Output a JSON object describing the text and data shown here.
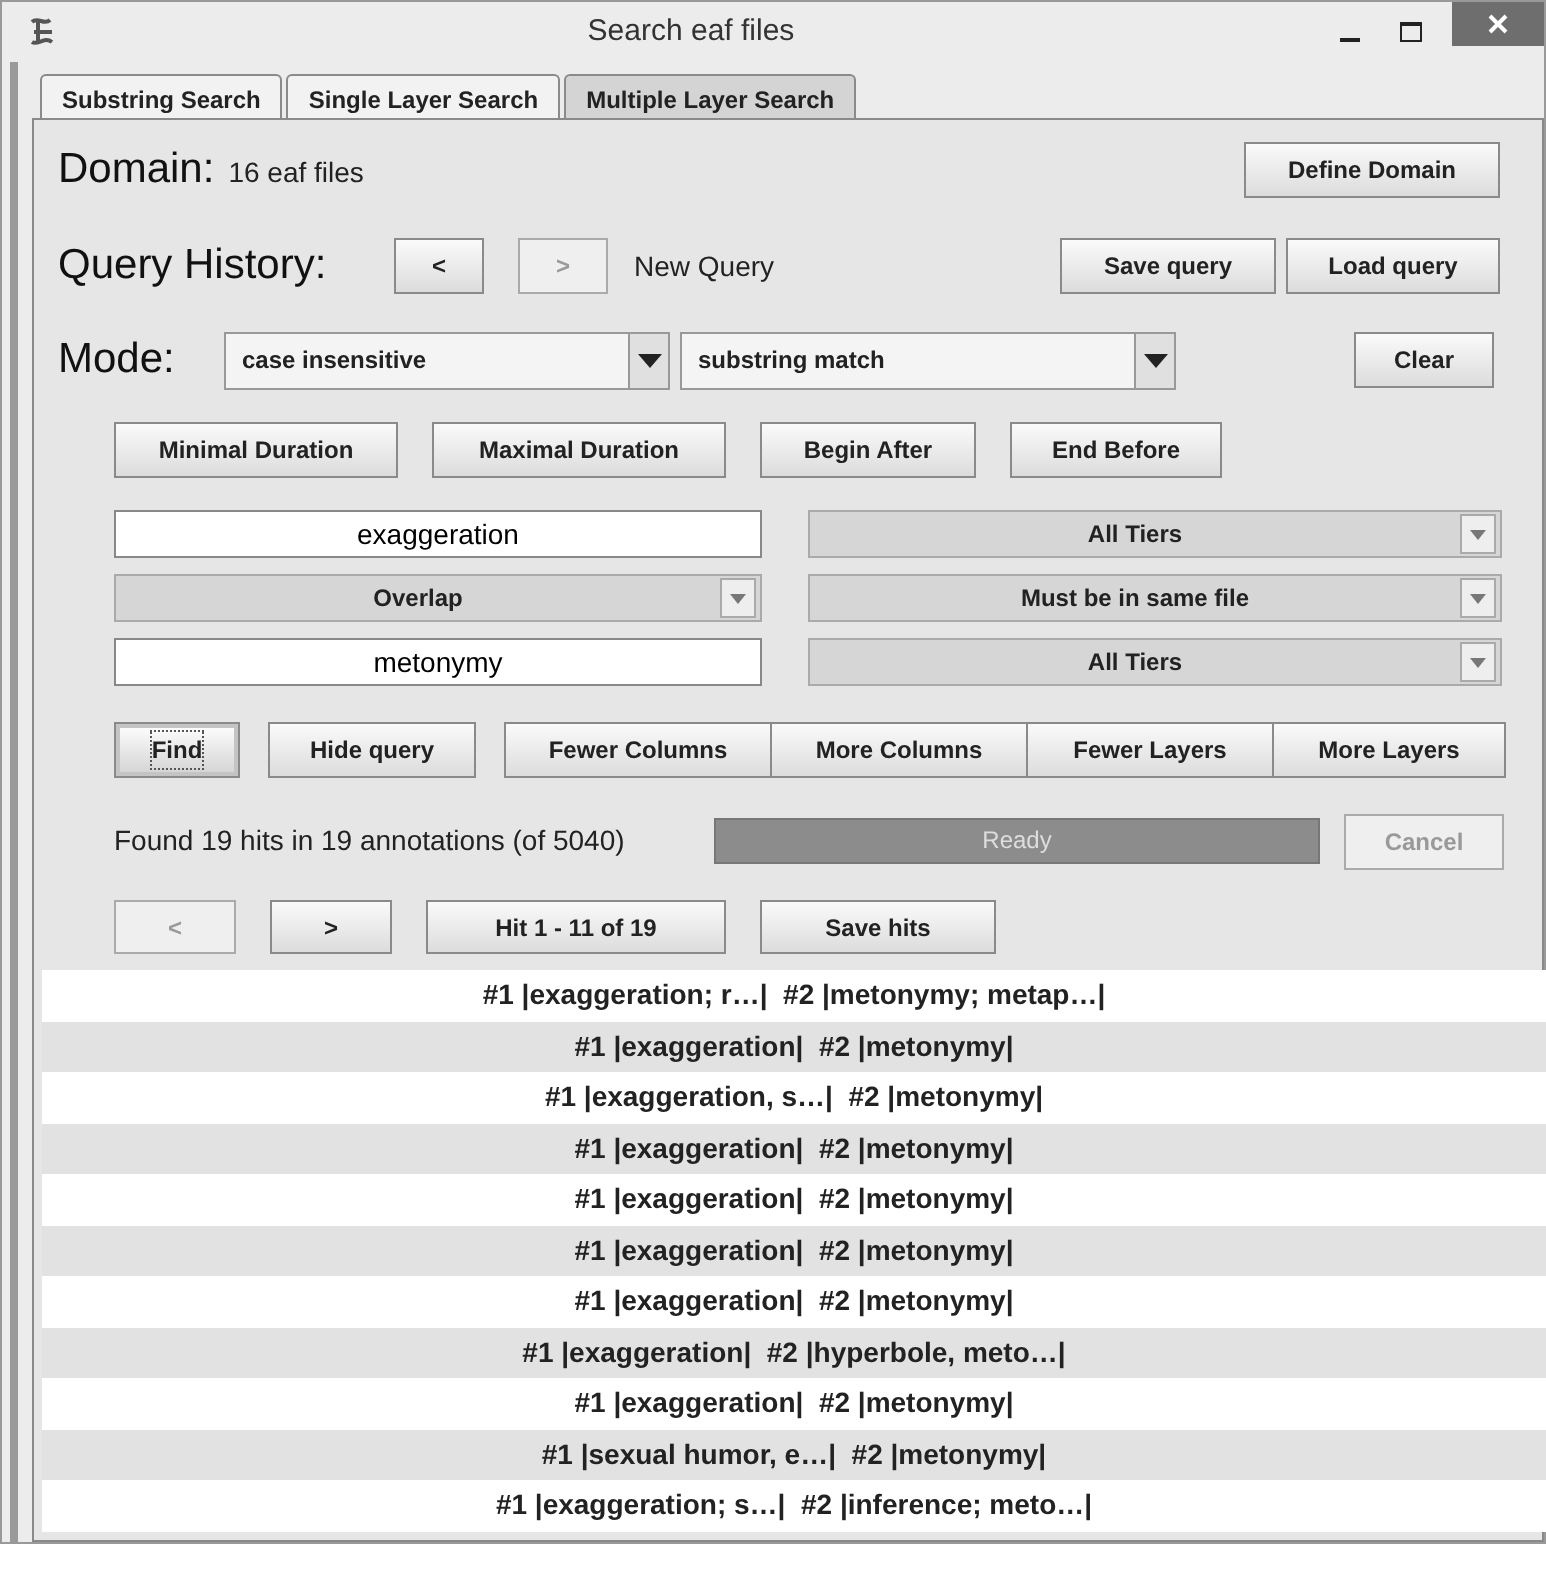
{
  "window": {
    "title": "Search eaf files"
  },
  "tabs": [
    {
      "label": "Substring Search",
      "selected": false
    },
    {
      "label": "Single Layer Search",
      "selected": false
    },
    {
      "label": "Multiple Layer Search",
      "selected": true
    }
  ],
  "domain": {
    "label": "Domain:",
    "value": "16 eaf files",
    "button": "Define Domain"
  },
  "query_history": {
    "label": "Query History:",
    "nav": [
      {
        "label": "<",
        "disabled": false
      },
      {
        "label": ">",
        "disabled": true
      }
    ],
    "status": "New Query",
    "buttons": [
      "Save query",
      "Load query"
    ]
  },
  "mode": {
    "label": "Mode:",
    "dropdowns": [
      "case insensitive",
      "substring match"
    ],
    "button": "Clear"
  },
  "constraints": [
    "Minimal Duration",
    "Maximal Duration",
    "Begin After",
    "End Before"
  ],
  "query_rows": [
    {
      "kind": "field",
      "value": "exaggeration",
      "tier": "All Tiers"
    },
    {
      "kind": "select",
      "value": "Overlap",
      "tier": "Must be in same file"
    },
    {
      "kind": "field",
      "value": "metonymy",
      "tier": "All Tiers"
    }
  ],
  "actions": [
    {
      "label": "Find",
      "kind": "single",
      "focused": true
    },
    {
      "label": "Hide query",
      "kind": "single",
      "focused": false
    },
    {
      "label": "Fewer Columns",
      "kind": "joined",
      "focused": false
    },
    {
      "label": "More Columns",
      "kind": "joined",
      "focused": false
    },
    {
      "label": "Fewer Layers",
      "kind": "joined",
      "focused": false
    },
    {
      "label": "More Layers",
      "kind": "joined",
      "focused": false
    }
  ],
  "status": {
    "text": "Found 19 hits in 19 annotations (of 5040)",
    "progress": {
      "label": "Ready",
      "level": 1
    },
    "cancel": {
      "label": "Cancel",
      "disabled": true
    }
  },
  "hits_nav": [
    {
      "label": "<",
      "disabled": true
    },
    {
      "label": ">",
      "disabled": false
    },
    {
      "label": "Hit 1 - 11 of 19",
      "disabled": false
    },
    {
      "label": "Save hits",
      "disabled": false
    }
  ],
  "results": [
    "#1 |exaggeration; r…|  #2 |metonymy; metap…|",
    "#1 |exaggeration|  #2 |metonymy|",
    "#1 |exaggeration, s…|  #2 |metonymy|",
    "#1 |exaggeration|  #2 |metonymy|",
    "#1 |exaggeration|  #2 |metonymy|",
    "#1 |exaggeration|  #2 |metonymy|",
    "#1 |exaggeration|  #2 |metonymy|",
    "#1 |exaggeration|  #2 |hyperbole, meto…|",
    "#1 |exaggeration|  #2 |metonymy|",
    "#1 |sexual humor, e…|  #2 |metonymy|",
    "#1 |exaggeration; s…|  #2 |inference; meto…|"
  ]
}
